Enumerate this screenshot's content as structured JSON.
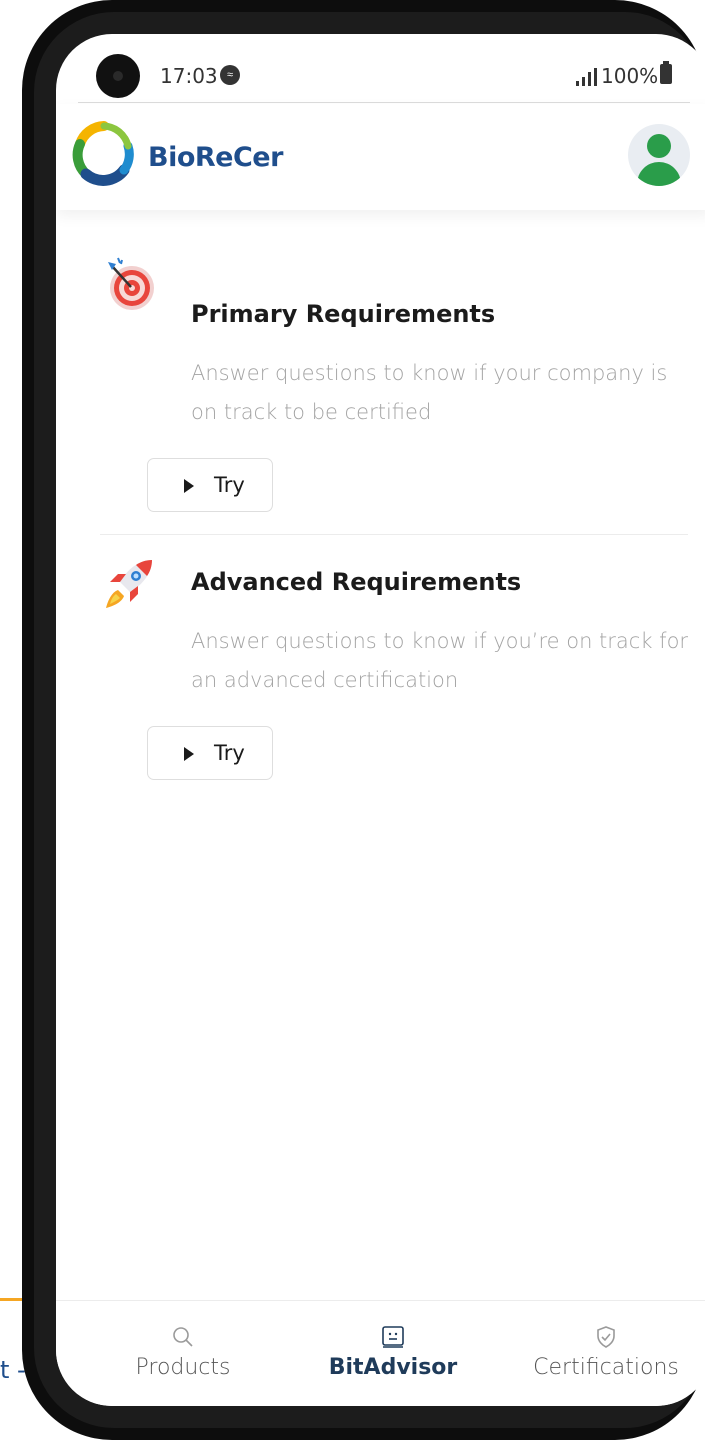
{
  "background": {
    "partial_text": "t -"
  },
  "status_bar": {
    "time": "17:03",
    "battery": "100%"
  },
  "header": {
    "brand": "BioReCer"
  },
  "cards": [
    {
      "title": "Primary Requirements",
      "description": "Answer questions to know if your company is on track to be certified",
      "button_label": "Try",
      "icon": "target-icon"
    },
    {
      "title": "Advanced Requirements",
      "description": "Answer questions to know if you’re on track for an advanced certification",
      "button_label": "Try",
      "icon": "rocket-icon"
    }
  ],
  "bottom_nav": {
    "items": [
      {
        "label": "Products",
        "icon": "search-icon",
        "active": false
      },
      {
        "label": "BitAdvisor",
        "icon": "advisor-icon",
        "active": true
      },
      {
        "label": "Certifications",
        "icon": "shield-check-icon",
        "active": false
      }
    ]
  },
  "colors": {
    "brand_blue": "#1f4e8c",
    "avatar_green": "#2a9d4a",
    "accent_orange": "#f5a623"
  }
}
